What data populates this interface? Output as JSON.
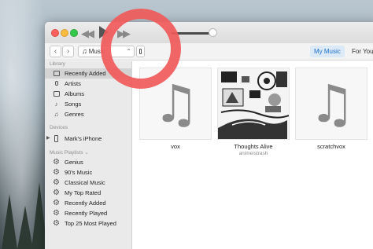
{
  "player": {
    "rewind_icon": "rewind-icon",
    "play_icon": "play-icon",
    "forward_icon": "fast-forward-icon",
    "volume_level": 0.9
  },
  "toolbar": {
    "back_glyph": "‹",
    "forward_glyph": "›",
    "media_kind_label": "Music",
    "device_icon": "iphone-icon",
    "tabs": [
      {
        "label": "My Music",
        "active": true
      },
      {
        "label": "For You",
        "active": false
      }
    ]
  },
  "sidebar": {
    "library_header": "Library",
    "library_items": [
      {
        "label": "Recently Added",
        "icon": "recently-added-icon",
        "selected": true
      },
      {
        "label": "Artists",
        "icon": "artists-icon",
        "selected": false
      },
      {
        "label": "Albums",
        "icon": "albums-icon",
        "selected": false
      },
      {
        "label": "Songs",
        "icon": "songs-icon",
        "selected": false
      },
      {
        "label": "Genres",
        "icon": "genres-icon",
        "selected": false
      }
    ],
    "devices_header": "Devices",
    "device_item": {
      "label": "Mark's iPhone",
      "icon": "iphone-icon"
    },
    "playlists_header": "Music Playlists ⌄",
    "playlists": [
      {
        "label": "Genius",
        "icon": "gear-icon"
      },
      {
        "label": "90's Music",
        "icon": "gear-icon"
      },
      {
        "label": "Classical Music",
        "icon": "gear-icon"
      },
      {
        "label": "My Top Rated",
        "icon": "gear-icon"
      },
      {
        "label": "Recently Added",
        "icon": "gear-icon"
      },
      {
        "label": "Recently Played",
        "icon": "gear-icon"
      },
      {
        "label": "Top 25 Most Played",
        "icon": "gear-icon"
      }
    ]
  },
  "albums": [
    {
      "title": "vox",
      "artist": "",
      "art": "music-note-placeholder-icon"
    },
    {
      "title": "Thoughts Alive",
      "artist": "animeistrash",
      "art": "album-artwork"
    },
    {
      "title": "scratchvox",
      "artist": "",
      "art": "music-note-placeholder-icon"
    }
  ],
  "colors": {
    "accent": "#1e6fc9",
    "highlight_ring": "#f05a5a",
    "selected_row": "#d3d3d3"
  }
}
